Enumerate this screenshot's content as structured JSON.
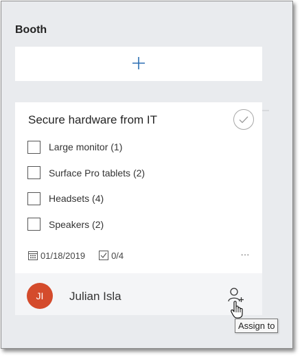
{
  "bucket": {
    "title": "Booth"
  },
  "add_task": {
    "icon": "plus-icon"
  },
  "task": {
    "title": "Secure hardware from IT",
    "checklist": [
      {
        "label": "Large monitor (1)",
        "checked": false
      },
      {
        "label": "Surface Pro tablets (2)",
        "checked": false
      },
      {
        "label": "Headsets (4)",
        "checked": false
      },
      {
        "label": "Speakers (2)",
        "checked": false
      }
    ],
    "due_date": "01/18/2019",
    "checklist_progress": "0/4",
    "more_label": "···"
  },
  "assignee": {
    "initials": "JI",
    "name": "Julian Isla",
    "avatar_color": "#d44b2c"
  },
  "tooltip": {
    "text": "Assign to"
  },
  "colors": {
    "accent": "#2b6fb3",
    "panel_bg": "#e9ebee",
    "card_bg": "#ffffff"
  }
}
